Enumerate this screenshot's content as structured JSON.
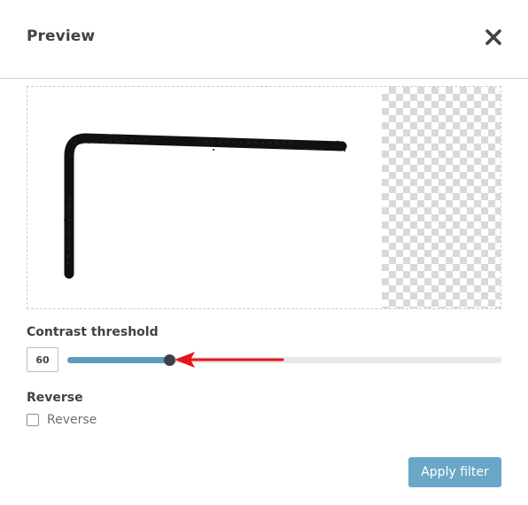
{
  "dialog": {
    "title": "Preview"
  },
  "contrast": {
    "label": "Contrast threshold",
    "value": "60",
    "fill_fraction": 0.235
  },
  "reverse": {
    "label": "Reverse",
    "checkbox_label": "Reverse",
    "checked": false
  },
  "actions": {
    "apply_label": "Apply filter"
  },
  "colors": {
    "slider_fill": "#5b9bbd",
    "slider_thumb": "#3d4046",
    "apply_button": "#6aa7c6",
    "annotation_arrow": "#e8141b"
  }
}
